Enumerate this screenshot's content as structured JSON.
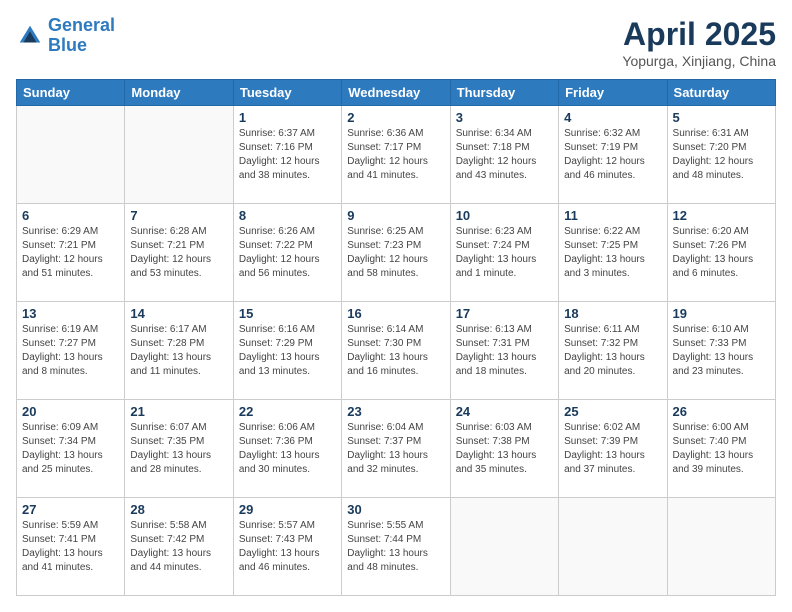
{
  "header": {
    "logo_line1": "General",
    "logo_line2": "Blue",
    "title": "April 2025",
    "subtitle": "Yopurga, Xinjiang, China"
  },
  "weekdays": [
    "Sunday",
    "Monday",
    "Tuesday",
    "Wednesday",
    "Thursday",
    "Friday",
    "Saturday"
  ],
  "weeks": [
    [
      {
        "day": "",
        "info": ""
      },
      {
        "day": "",
        "info": ""
      },
      {
        "day": "1",
        "info": "Sunrise: 6:37 AM\nSunset: 7:16 PM\nDaylight: 12 hours and 38 minutes."
      },
      {
        "day": "2",
        "info": "Sunrise: 6:36 AM\nSunset: 7:17 PM\nDaylight: 12 hours and 41 minutes."
      },
      {
        "day": "3",
        "info": "Sunrise: 6:34 AM\nSunset: 7:18 PM\nDaylight: 12 hours and 43 minutes."
      },
      {
        "day": "4",
        "info": "Sunrise: 6:32 AM\nSunset: 7:19 PM\nDaylight: 12 hours and 46 minutes."
      },
      {
        "day": "5",
        "info": "Sunrise: 6:31 AM\nSunset: 7:20 PM\nDaylight: 12 hours and 48 minutes."
      }
    ],
    [
      {
        "day": "6",
        "info": "Sunrise: 6:29 AM\nSunset: 7:21 PM\nDaylight: 12 hours and 51 minutes."
      },
      {
        "day": "7",
        "info": "Sunrise: 6:28 AM\nSunset: 7:21 PM\nDaylight: 12 hours and 53 minutes."
      },
      {
        "day": "8",
        "info": "Sunrise: 6:26 AM\nSunset: 7:22 PM\nDaylight: 12 hours and 56 minutes."
      },
      {
        "day": "9",
        "info": "Sunrise: 6:25 AM\nSunset: 7:23 PM\nDaylight: 12 hours and 58 minutes."
      },
      {
        "day": "10",
        "info": "Sunrise: 6:23 AM\nSunset: 7:24 PM\nDaylight: 13 hours and 1 minute."
      },
      {
        "day": "11",
        "info": "Sunrise: 6:22 AM\nSunset: 7:25 PM\nDaylight: 13 hours and 3 minutes."
      },
      {
        "day": "12",
        "info": "Sunrise: 6:20 AM\nSunset: 7:26 PM\nDaylight: 13 hours and 6 minutes."
      }
    ],
    [
      {
        "day": "13",
        "info": "Sunrise: 6:19 AM\nSunset: 7:27 PM\nDaylight: 13 hours and 8 minutes."
      },
      {
        "day": "14",
        "info": "Sunrise: 6:17 AM\nSunset: 7:28 PM\nDaylight: 13 hours and 11 minutes."
      },
      {
        "day": "15",
        "info": "Sunrise: 6:16 AM\nSunset: 7:29 PM\nDaylight: 13 hours and 13 minutes."
      },
      {
        "day": "16",
        "info": "Sunrise: 6:14 AM\nSunset: 7:30 PM\nDaylight: 13 hours and 16 minutes."
      },
      {
        "day": "17",
        "info": "Sunrise: 6:13 AM\nSunset: 7:31 PM\nDaylight: 13 hours and 18 minutes."
      },
      {
        "day": "18",
        "info": "Sunrise: 6:11 AM\nSunset: 7:32 PM\nDaylight: 13 hours and 20 minutes."
      },
      {
        "day": "19",
        "info": "Sunrise: 6:10 AM\nSunset: 7:33 PM\nDaylight: 13 hours and 23 minutes."
      }
    ],
    [
      {
        "day": "20",
        "info": "Sunrise: 6:09 AM\nSunset: 7:34 PM\nDaylight: 13 hours and 25 minutes."
      },
      {
        "day": "21",
        "info": "Sunrise: 6:07 AM\nSunset: 7:35 PM\nDaylight: 13 hours and 28 minutes."
      },
      {
        "day": "22",
        "info": "Sunrise: 6:06 AM\nSunset: 7:36 PM\nDaylight: 13 hours and 30 minutes."
      },
      {
        "day": "23",
        "info": "Sunrise: 6:04 AM\nSunset: 7:37 PM\nDaylight: 13 hours and 32 minutes."
      },
      {
        "day": "24",
        "info": "Sunrise: 6:03 AM\nSunset: 7:38 PM\nDaylight: 13 hours and 35 minutes."
      },
      {
        "day": "25",
        "info": "Sunrise: 6:02 AM\nSunset: 7:39 PM\nDaylight: 13 hours and 37 minutes."
      },
      {
        "day": "26",
        "info": "Sunrise: 6:00 AM\nSunset: 7:40 PM\nDaylight: 13 hours and 39 minutes."
      }
    ],
    [
      {
        "day": "27",
        "info": "Sunrise: 5:59 AM\nSunset: 7:41 PM\nDaylight: 13 hours and 41 minutes."
      },
      {
        "day": "28",
        "info": "Sunrise: 5:58 AM\nSunset: 7:42 PM\nDaylight: 13 hours and 44 minutes."
      },
      {
        "day": "29",
        "info": "Sunrise: 5:57 AM\nSunset: 7:43 PM\nDaylight: 13 hours and 46 minutes."
      },
      {
        "day": "30",
        "info": "Sunrise: 5:55 AM\nSunset: 7:44 PM\nDaylight: 13 hours and 48 minutes."
      },
      {
        "day": "",
        "info": ""
      },
      {
        "day": "",
        "info": ""
      },
      {
        "day": "",
        "info": ""
      }
    ]
  ]
}
